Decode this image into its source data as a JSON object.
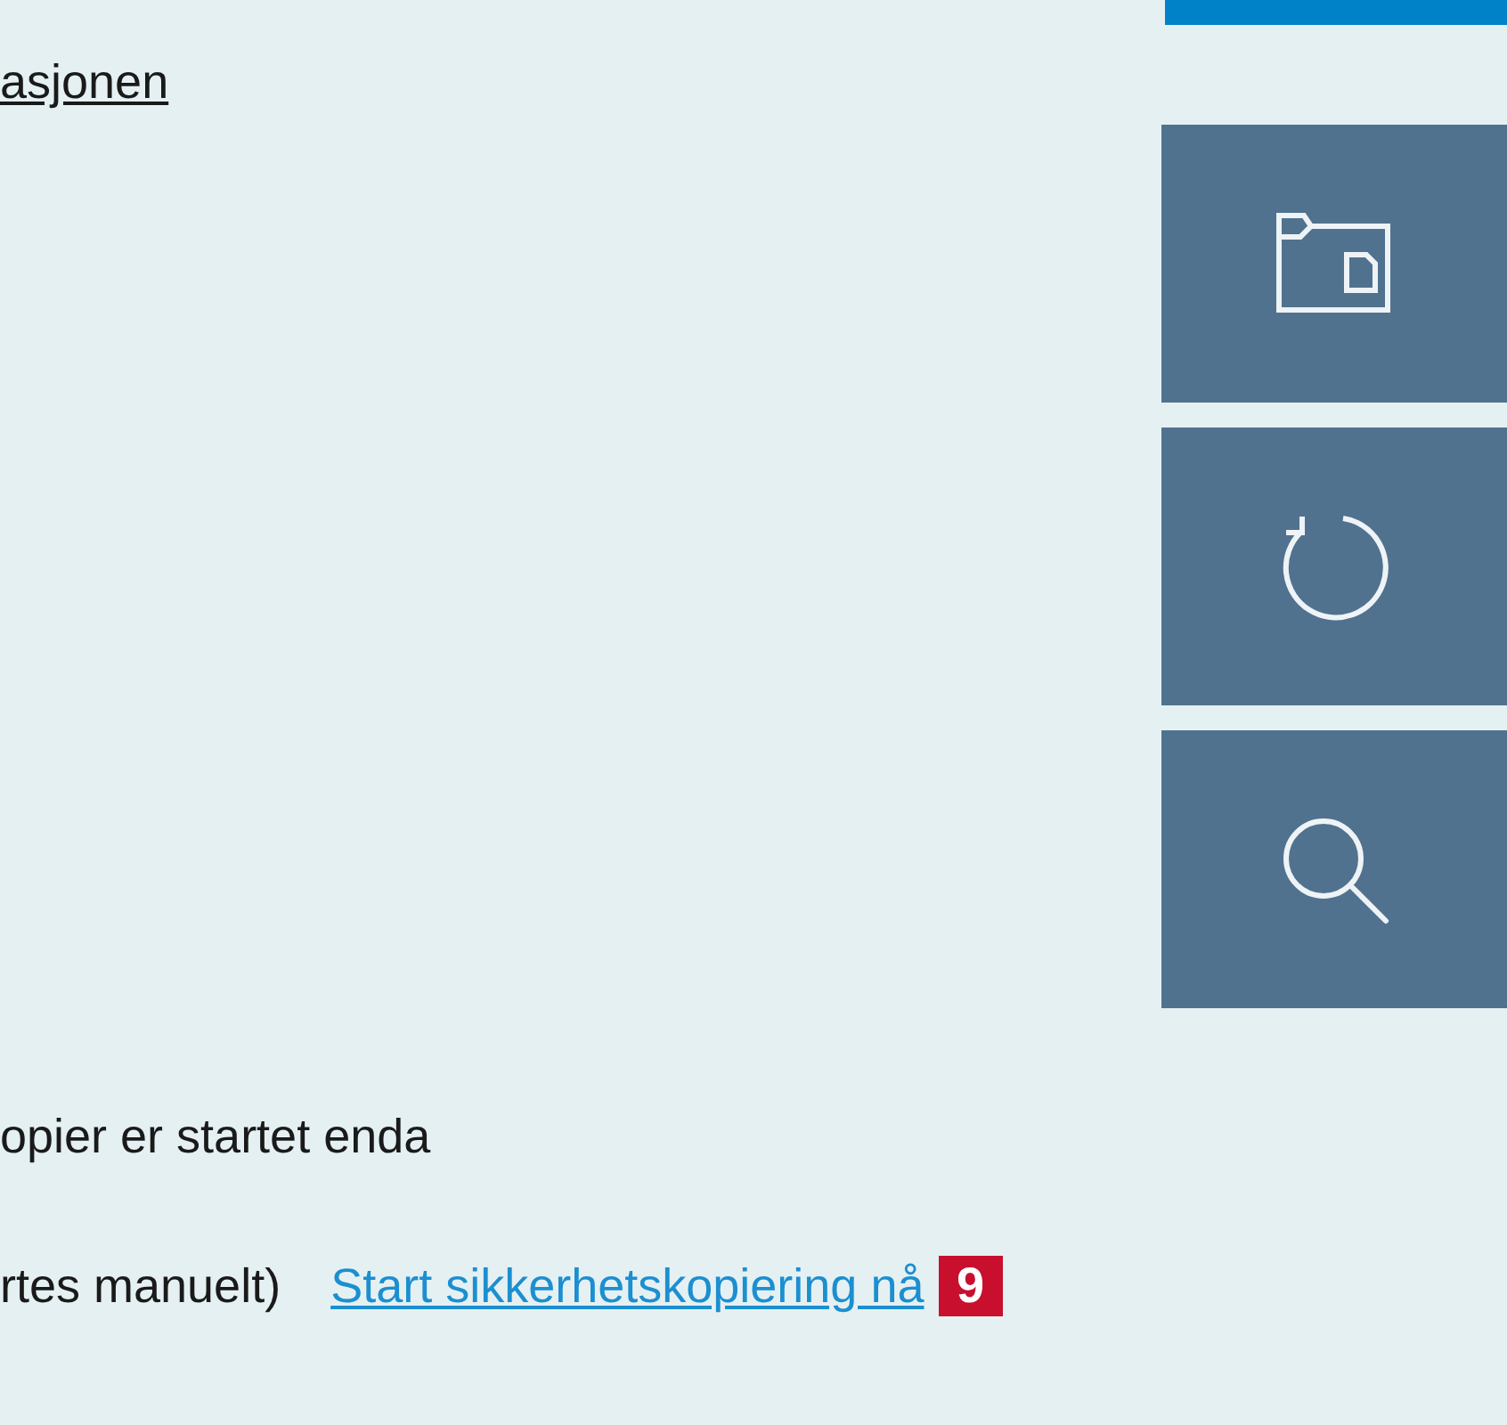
{
  "top_link": "asjonen",
  "status_text": "opier er startet enda",
  "schedule_text": "rtes manuelt)",
  "start_link": "Start sikkerhetskopiering nå",
  "callout_badge": "9",
  "side_buttons": [
    {
      "kind": "folder"
    },
    {
      "kind": "restore"
    },
    {
      "kind": "search"
    }
  ]
}
